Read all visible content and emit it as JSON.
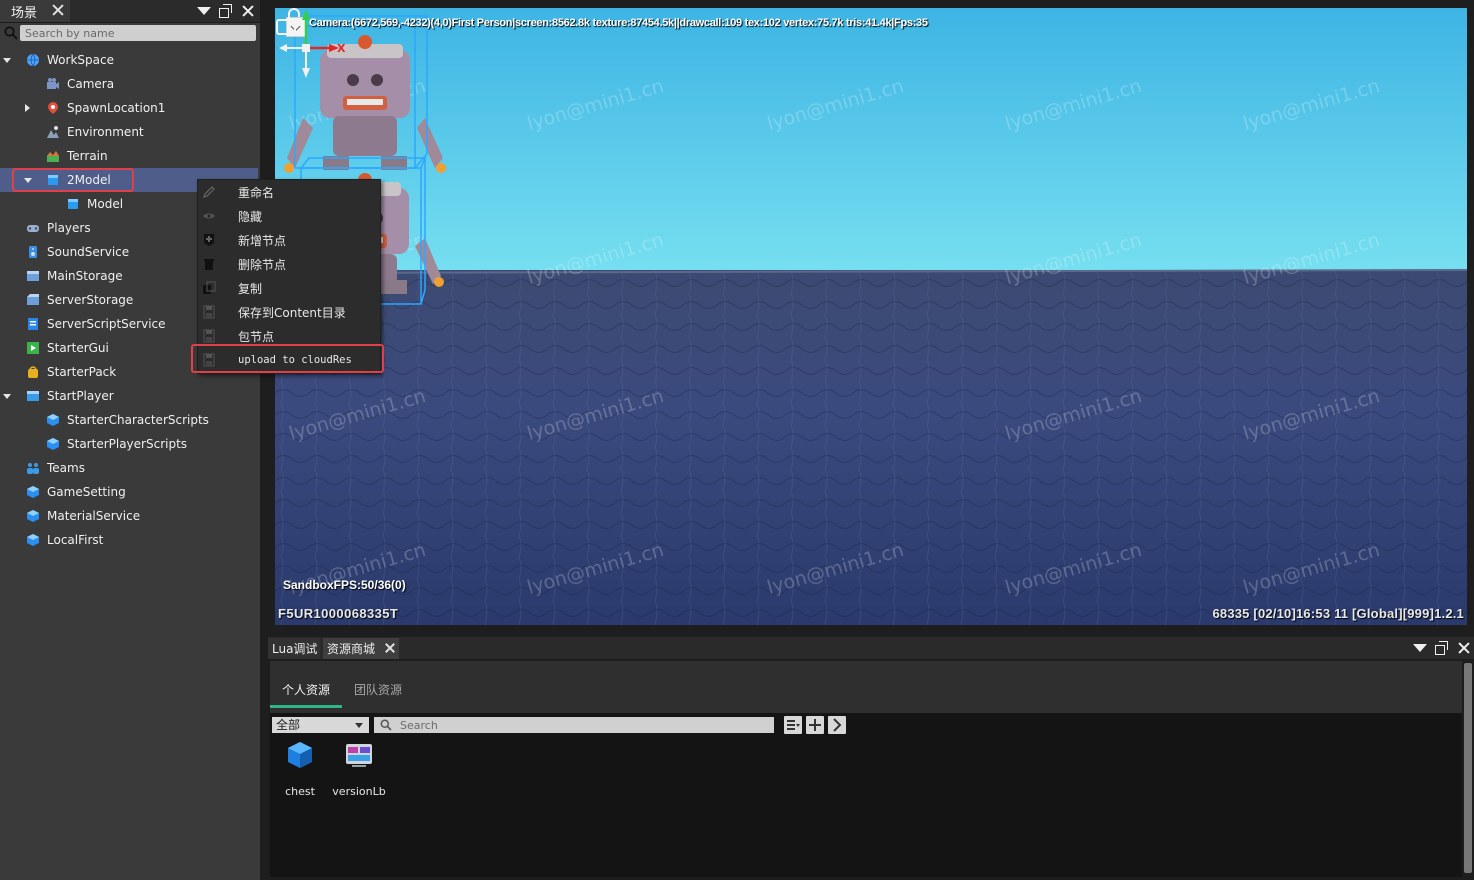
{
  "scene": {
    "tab_label": "场景",
    "search_placeholder": "Search by name",
    "tree": [
      {
        "label": "WorkSpace",
        "indent": 0,
        "arrow": "open",
        "icon": "globe-icon",
        "color": "#4da3ff"
      },
      {
        "label": "Camera",
        "indent": 1,
        "arrow": "",
        "icon": "camera-icon",
        "color": "#7c95c7"
      },
      {
        "label": "SpawnLocation1",
        "indent": 1,
        "arrow": "closed",
        "icon": "spawn-icon",
        "color": "#e0503a"
      },
      {
        "label": "Environment",
        "indent": 1,
        "arrow": "",
        "icon": "environment-icon",
        "color": "#8aa0b8"
      },
      {
        "label": "Terrain",
        "indent": 1,
        "arrow": "",
        "icon": "terrain-icon",
        "color": "#d07a3a"
      },
      {
        "label": "2Model",
        "indent": 1,
        "arrow": "open",
        "icon": "model-cube-icon",
        "color": "#2a9bf0",
        "selected": true
      },
      {
        "label": "Model",
        "indent": 2,
        "arrow": "",
        "icon": "model-cube-icon",
        "color": "#2a9bf0"
      },
      {
        "label": "Players",
        "indent": 0,
        "arrow": "",
        "icon": "players-icon",
        "color": "#9ab0d0"
      },
      {
        "label": "SoundService",
        "indent": 0,
        "arrow": "",
        "icon": "sound-icon",
        "color": "#3a8fe0"
      },
      {
        "label": "MainStorage",
        "indent": 0,
        "arrow": "",
        "icon": "storage-icon",
        "color": "#6da0d8"
      },
      {
        "label": "ServerStorage",
        "indent": 0,
        "arrow": "",
        "icon": "server-storage-icon",
        "color": "#6da0d8"
      },
      {
        "label": "ServerScriptService",
        "indent": 0,
        "arrow": "",
        "icon": "script-service-icon",
        "color": "#2a86e8"
      },
      {
        "label": "StarterGui",
        "indent": 0,
        "arrow": "",
        "icon": "gui-icon",
        "color": "#3bb24a"
      },
      {
        "label": "StarterPack",
        "indent": 0,
        "arrow": "",
        "icon": "pack-icon",
        "color": "#e8b020"
      },
      {
        "label": "StartPlayer",
        "indent": 0,
        "arrow": "open",
        "icon": "player-window-icon",
        "color": "#3a9be8"
      },
      {
        "label": "StarterCharacterScripts",
        "indent": 1,
        "arrow": "",
        "icon": "gem-icon",
        "color": "#2a8ff0"
      },
      {
        "label": "StarterPlayerScripts",
        "indent": 1,
        "arrow": "",
        "icon": "gem-icon",
        "color": "#2a8ff0"
      },
      {
        "label": "Teams",
        "indent": 0,
        "arrow": "",
        "icon": "teams-icon",
        "color": "#3a9be8"
      },
      {
        "label": "GameSetting",
        "indent": 0,
        "arrow": "",
        "icon": "gem-icon",
        "color": "#2a8ff0"
      },
      {
        "label": "MaterialService",
        "indent": 0,
        "arrow": "",
        "icon": "gem-icon",
        "color": "#2a8ff0"
      },
      {
        "label": "LocalFirst",
        "indent": 0,
        "arrow": "",
        "icon": "gem-icon",
        "color": "#2a8ff0"
      }
    ]
  },
  "context_menu": {
    "items": [
      {
        "label": "重命名",
        "icon": "pencil-icon"
      },
      {
        "label": "隐藏",
        "icon": "eye-icon"
      },
      {
        "label": "新增节点",
        "icon": "add-node-icon"
      },
      {
        "label": "删除节点",
        "icon": "trash-icon"
      },
      {
        "label": "复制",
        "icon": "copy-icon"
      },
      {
        "label": "保存到Content目录",
        "icon": "save-icon"
      },
      {
        "label": "包节点",
        "icon": "save-icon"
      },
      {
        "label": "upload to cloudRes",
        "icon": "save-icon",
        "mono": true
      }
    ]
  },
  "viewport": {
    "stats": "Camera:(6672,569,-4232)(4,0)First Person|screen:8562.8k texture:87454.5k||drawcall:109 tex:102 vertex:75.7k tris:41.4k|Fps:35",
    "sandbox_fps": "SandboxFPS:50/36(0)",
    "device_code": "F5UR1000068335T",
    "status": "68335   [02/10]16:53 11  [Global][999]1.2.1",
    "watermark": "lyon@mini1.cn",
    "gizmo_x_label": "X",
    "colors": {
      "sky_top": "#3fb8e6",
      "sky_bottom": "#73dcee",
      "ground": "#3a4a78",
      "selection": "#2aa8ff"
    }
  },
  "bottom_panel": {
    "tabs": [
      {
        "label": "Lua调试"
      },
      {
        "label": "资源商城"
      }
    ],
    "subtabs": {
      "personal": "个人资源",
      "team": "团队资源"
    },
    "filter_value": "全部",
    "search_placeholder": "Search",
    "assets": [
      {
        "label": "chest",
        "icon": "chest-cube-icon"
      },
      {
        "label": "versionLb",
        "icon": "ui-window-icon"
      }
    ],
    "accent": "#2fb58a"
  }
}
